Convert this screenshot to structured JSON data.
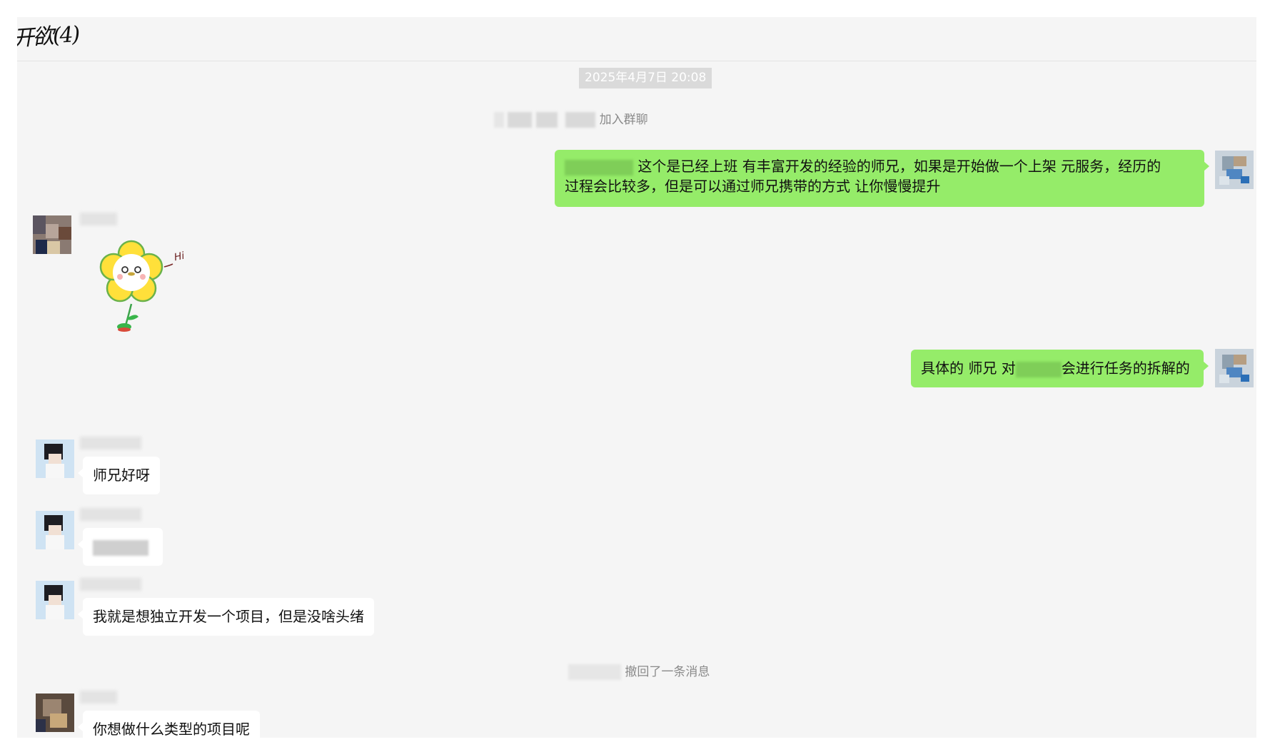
{
  "chat": {
    "title": "开欲(4)"
  },
  "timestamp": "2025年4月7日 20:08",
  "system_messages": {
    "join_suffix": "加入群聊",
    "recall_suffix": "撤回了一条消息"
  },
  "messages": [
    {
      "side": "me",
      "text_after_mention": "这个是已经上班 有丰富开发的经验的师兄，如果是开始做一个上架 元服务，经历的",
      "text_line2": "过程会比较多，但是可以通过师兄携带的方式 让你慢慢提升"
    },
    {
      "side": "other",
      "sticker": "flower-hi",
      "sticker_text": "Hi"
    },
    {
      "side": "me",
      "text_before": "具体的 师兄 对",
      "text_after": "会进行任务的拆解的"
    },
    {
      "side": "other",
      "text": "师兄好呀"
    },
    {
      "side": "other",
      "text": ""
    },
    {
      "side": "other",
      "text": "我就是想独立开发一个项目，但是没啥头绪"
    },
    {
      "side": "other",
      "text": "你想做什么类型的项目呢"
    }
  ],
  "colors": {
    "panel_bg": "#f5f5f5",
    "me_bubble": "#95ec69",
    "other_bubble": "#ffffff",
    "timestamp_bg": "#dadada",
    "system_text": "#8a8a8a"
  }
}
